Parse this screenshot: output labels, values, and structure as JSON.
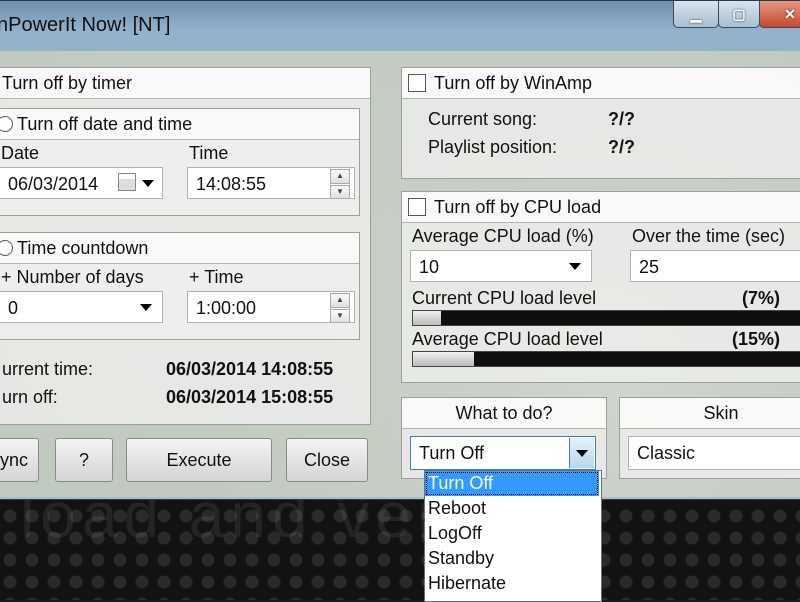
{
  "window": {
    "title": "UnPowerIt Now! [NT]",
    "title_visible": "nPowerIt Now! [NT]"
  },
  "timer": {
    "group_label": "Turn off by timer",
    "date_time_option": "Turn off date and time",
    "date_label": "Date",
    "date_value": "06/03/2014",
    "time_label": "Time",
    "time_value": "14:08:55",
    "countdown_option": "Time countdown",
    "days_label": "+ Number of days",
    "days_value": "0",
    "plus_time_label": "+ Time",
    "plus_time_value": "1:00:00",
    "current_time_label": "urrent time:",
    "current_time_value": "06/03/2014 14:08:55",
    "turn_off_label": "urn off:",
    "turn_off_value": "06/03/2014 15:08:55"
  },
  "buttons": {
    "sync": "ync",
    "help": "?",
    "execute": "Execute",
    "close": "Close"
  },
  "winamp": {
    "label": "Turn off by WinAmp",
    "song_label": "Current song:",
    "song_value": "?/?",
    "playlist_label": "Playlist position:",
    "playlist_value": "?/?"
  },
  "cpu": {
    "label": "Turn off by CPU load",
    "avg_load_label": "Average CPU load (%)",
    "avg_load_value": "10",
    "over_time_label": "Over the time (sec)",
    "over_time_value": "25",
    "current_level_label": "Current CPU load level",
    "current_level_value": "(7%)",
    "current_level_fraction": 0.07,
    "avg_level_label": "Average CPU load level",
    "avg_level_value": "(15%)",
    "avg_level_fraction": 0.15
  },
  "action": {
    "label": "What to do?",
    "selected": "Turn Off",
    "options": [
      "Turn Off",
      "Reboot",
      "LogOff",
      "Standby",
      "Hibernate"
    ]
  },
  "skin": {
    "label": "Skin",
    "selected": "Classic"
  },
  "desktop_text": "load and ver"
}
